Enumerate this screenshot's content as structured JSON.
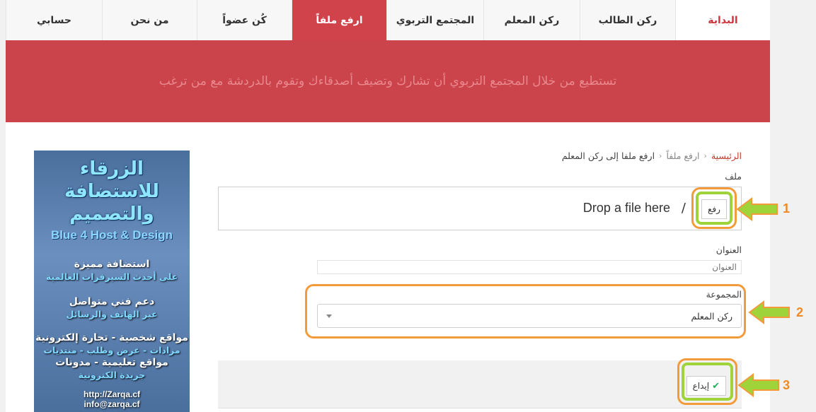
{
  "nav": {
    "items": [
      {
        "label": "البداية"
      },
      {
        "label": "ركن الطالب"
      },
      {
        "label": "ركن المعلم"
      },
      {
        "label": "المجتمع التربوي"
      },
      {
        "label": "ارفع ملفاً"
      },
      {
        "label": "كُن عضواً"
      },
      {
        "label": "من نحن"
      },
      {
        "label": "حسابي"
      }
    ]
  },
  "hero": {
    "text": "تستطيع من خلال المجتمع التربوي أن تشارك وتضيف أصدقاءك وتقوم بالدردشة مع من ترغب"
  },
  "breadcrumb": {
    "home": "الرئيسية",
    "section": "ارفع ملفاً",
    "current": "ارفع ملفا إلى ركن المعلم"
  },
  "form": {
    "file_label": "ملف",
    "drop_text": "Drop a file here",
    "drop_separator": "/",
    "upload_button": "رفع",
    "title_label": "العنوان",
    "title_placeholder": "العنوان",
    "group_label": "المجموعة",
    "group_value": "ركن المعلم",
    "submit_button": "إيداع",
    "submit_icon": "check-icon"
  },
  "annotations": {
    "step1": "1",
    "step2": "2",
    "step3": "3",
    "highlight_color": "#f39a3a",
    "arrow_color": "#9ed43a"
  },
  "ad": {
    "title_ar": "الزرقاء للاستضافة والتصميم",
    "title_en": "Blue 4 Host & Design",
    "line1": "استضافة مميزة",
    "line2": "على أحدث السيرفرات العالمية",
    "line3": "دعم فني متواصل",
    "line4": "عبر الهاتف والرسائل",
    "line5": "مواقع شخصية - تجارة إلكترونية",
    "line6": "مزادات - عرض وطلب - منتديات",
    "line7": "مواقع تعليمية - مدونات",
    "line8": "جريدة الكترونية",
    "url": "http://Zarqa.cf",
    "email": "info@zarqa.cf"
  },
  "colors": {
    "brand_red": "#cc444b",
    "active_tab": "#d0434b",
    "home_link": "#d0343c"
  }
}
